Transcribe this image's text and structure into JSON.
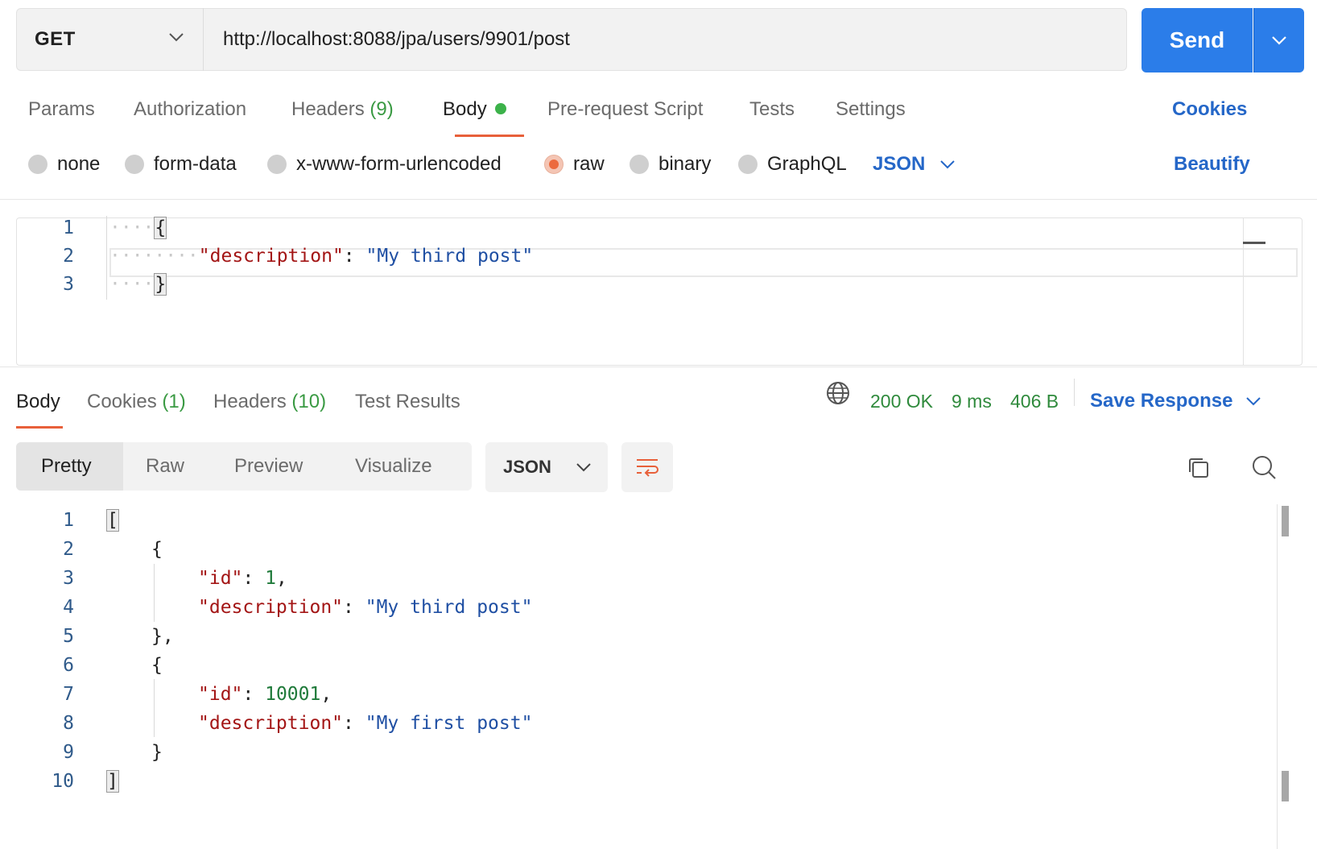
{
  "request": {
    "method": "GET",
    "url": "http://localhost:8088/jpa/users/9901/post",
    "send_label": "Send"
  },
  "request_tabs": {
    "params": "Params",
    "authorization": "Authorization",
    "headers": "Headers",
    "headers_count": "(9)",
    "body": "Body",
    "pre_request": "Pre-request Script",
    "tests": "Tests",
    "settings": "Settings",
    "cookies": "Cookies"
  },
  "body_modes": {
    "none": "none",
    "form_data": "form-data",
    "urlencoded": "x-www-form-urlencoded",
    "raw": "raw",
    "binary": "binary",
    "graphql": "GraphQL",
    "format": "JSON",
    "beautify": "Beautify",
    "selected": "raw"
  },
  "request_body": {
    "line_numbers": [
      "1",
      "2",
      "3"
    ],
    "open": "{",
    "key": "\"description\"",
    "colon": ": ",
    "value": "\"My third post\"",
    "close": "}"
  },
  "response_tabs": {
    "body": "Body",
    "cookies": "Cookies",
    "cookies_count": "(1)",
    "headers": "Headers",
    "headers_count": "(10)",
    "test_results": "Test Results"
  },
  "response_meta": {
    "status": "200 OK",
    "time": "9 ms",
    "size": "406 B",
    "save_response": "Save Response"
  },
  "view_modes": {
    "pretty": "Pretty",
    "raw": "Raw",
    "preview": "Preview",
    "visualize": "Visualize",
    "format": "JSON"
  },
  "response_body": {
    "line_numbers": [
      "1",
      "2",
      "3",
      "4",
      "5",
      "6",
      "7",
      "8",
      "9",
      "10"
    ],
    "lines": {
      "l1": "[",
      "l2": "{",
      "l3_key": "\"id\"",
      "l3_val": "1",
      "l4_key": "\"description\"",
      "l4_val": "\"My third post\"",
      "l5": "},",
      "l6": "{",
      "l7_key": "\"id\"",
      "l7_val": "10001",
      "l8_key": "\"description\"",
      "l8_val": "\"My first post\"",
      "l9": "}",
      "l10": "]"
    },
    "colon": ": ",
    "comma": ","
  },
  "colors": {
    "accent": "#2b7de9",
    "tab_underline": "#e8603a",
    "success": "#2f8a3c",
    "json_key": "#a31515",
    "json_string": "#1f4fa3",
    "json_number": "#1f7a3a"
  }
}
